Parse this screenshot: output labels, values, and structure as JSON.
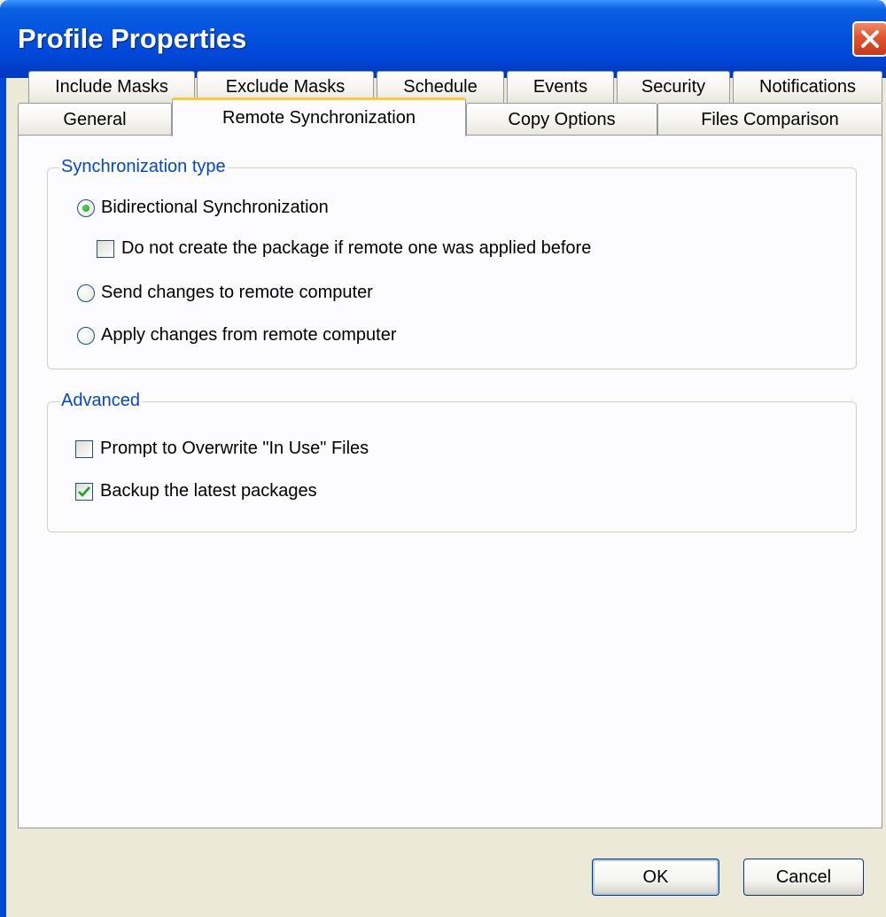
{
  "window": {
    "title": "Profile Properties"
  },
  "tabs_row1": [
    {
      "label": "Include Masks"
    },
    {
      "label": "Exclude Masks"
    },
    {
      "label": "Schedule"
    },
    {
      "label": "Events"
    },
    {
      "label": "Security"
    },
    {
      "label": "Notifications"
    }
  ],
  "tabs_row2": [
    {
      "label": "General"
    },
    {
      "label": "Remote Synchronization",
      "active": true
    },
    {
      "label": "Copy Options"
    },
    {
      "label": "Files Comparison"
    }
  ],
  "sync_type": {
    "label": "Synchronization type",
    "bidirectional": {
      "label": "Bidirectional Synchronization",
      "checked": true
    },
    "no_package": {
      "label": "Do not create the package if remote one was applied before",
      "checked": false
    },
    "send": {
      "label": "Send changes to remote computer",
      "checked": false
    },
    "apply": {
      "label": "Apply changes from remote computer",
      "checked": false
    }
  },
  "advanced": {
    "label": "Advanced",
    "prompt_overwrite": {
      "label": "Prompt to Overwrite \"In Use\" Files",
      "checked": false
    },
    "backup_packages": {
      "label": "Backup the latest packages",
      "checked": true
    }
  },
  "buttons": {
    "ok": "OK",
    "cancel": "Cancel"
  },
  "colors": {
    "titlebar": "#0454e0",
    "group_label": "#0046d5",
    "active_tab_highlight": "#ffc83c",
    "radio_dot": "#21a121",
    "check_mark": "#21a121"
  }
}
